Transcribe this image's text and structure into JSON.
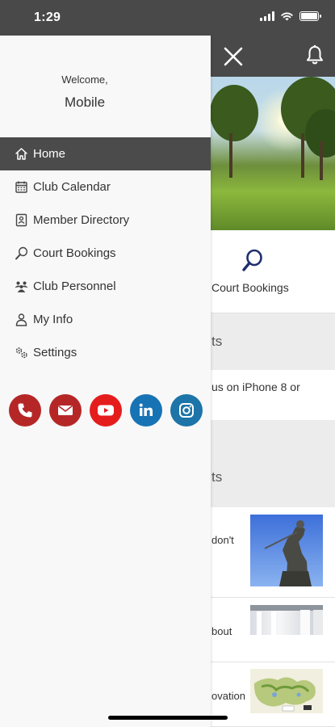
{
  "status_bar": {
    "time": "1:29"
  },
  "drawer": {
    "welcome": "Welcome,",
    "username": "Mobile",
    "menu": [
      {
        "label": "Home",
        "icon": "home-icon",
        "active": true
      },
      {
        "label": "Club Calendar",
        "icon": "calendar-icon",
        "active": false
      },
      {
        "label": "Member Directory",
        "icon": "contact-card-icon",
        "active": false
      },
      {
        "label": "Court Bookings",
        "icon": "racquet-icon",
        "active": false
      },
      {
        "label": "Club Personnel",
        "icon": "people-icon",
        "active": false
      },
      {
        "label": "My Info",
        "icon": "person-icon",
        "active": false
      },
      {
        "label": "Settings",
        "icon": "gears-icon",
        "active": false
      }
    ],
    "social": [
      {
        "icon": "phone-icon",
        "color": "#b52727"
      },
      {
        "icon": "email-icon",
        "color": "#b52727"
      },
      {
        "icon": "youtube-icon",
        "color": "#e51c1c"
      },
      {
        "icon": "linkedin-icon",
        "color": "#1873b5"
      },
      {
        "icon": "instagram-icon",
        "color": "#1c74a8"
      }
    ]
  },
  "background": {
    "tile_label": "Court Bookings",
    "section1_title": "ts",
    "section2_text": "us on iPhone 8 or",
    "section3_title": "ts",
    "news": [
      {
        "text": "don't"
      },
      {
        "text": "bout"
      },
      {
        "text": "ovation"
      }
    ]
  },
  "colors": {
    "header": "#494949",
    "active_item": "#4b4b4b",
    "drawer_bg": "#f8f8f8",
    "icon_navy": "#1f2f6e"
  }
}
